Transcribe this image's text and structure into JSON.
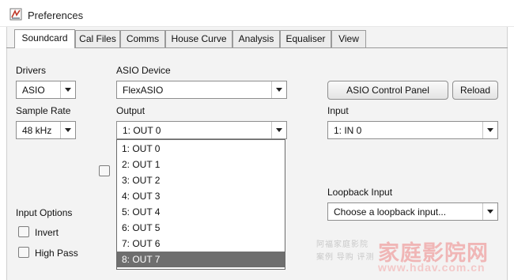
{
  "window": {
    "title": "Preferences"
  },
  "tabs": [
    {
      "label": "Soundcard",
      "active": true
    },
    {
      "label": "Cal Files",
      "active": false
    },
    {
      "label": "Comms",
      "active": false
    },
    {
      "label": "House Curve",
      "active": false
    },
    {
      "label": "Analysis",
      "active": false
    },
    {
      "label": "Equaliser",
      "active": false
    },
    {
      "label": "View",
      "active": false
    }
  ],
  "soundcard": {
    "drivers_label": "Drivers",
    "drivers_value": "ASIO",
    "asio_device_label": "ASIO Device",
    "asio_device_value": "FlexASIO",
    "asio_control_panel_button": "ASIO Control Panel",
    "reload_button": "Reload",
    "sample_rate_label": "Sample Rate",
    "sample_rate_value": "48 kHz",
    "output_label": "Output",
    "output_value": "1: OUT 0",
    "input_label": "Input",
    "input_value": "1: IN 0",
    "loopback_label": "Loopback Input",
    "loopback_value": "Choose a loopback input...",
    "input_options_label": "Input Options",
    "invert_label": "Invert",
    "high_pass_label": "High Pass"
  },
  "output_dropdown": {
    "options": [
      "1: OUT 0",
      "2: OUT 1",
      "3: OUT 2",
      "4: OUT 3",
      "5: OUT 4",
      "6: OUT 5",
      "7: OUT 6",
      "8: OUT 7"
    ],
    "highlighted": "8: OUT 7"
  },
  "watermark": {
    "small_line1": "阿福家庭影院",
    "small_line2": "案例 导购 评测",
    "big_text": "家庭影院网",
    "url": "www.hdav.com.cn"
  }
}
